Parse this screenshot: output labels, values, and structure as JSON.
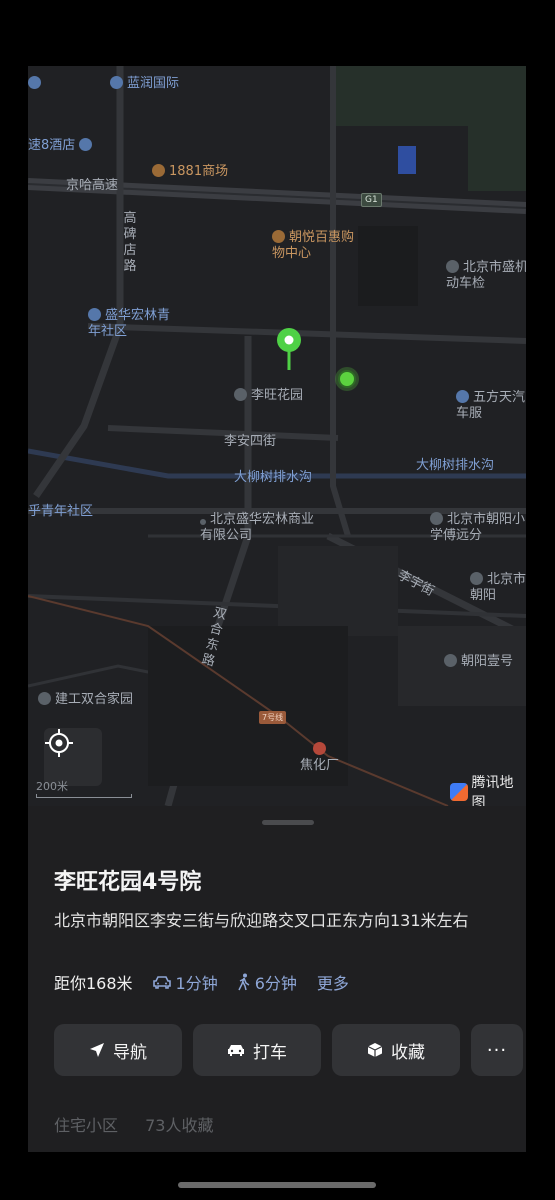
{
  "map": {
    "labels": {
      "lanrun": "蓝润国际",
      "hotel8": "速8酒店",
      "mall1881": "1881商场",
      "jingha": "京哈高速",
      "g1": "G1",
      "gaobeidian": "高碑店路",
      "chaoyue": "朝悦百惠购物中心",
      "beijing_shengjidong": "北京市盛机动车检",
      "shenghua": "盛华宏林青年社区",
      "liwang": "李旺花园",
      "wufang": "五方天汽车服",
      "lian4": "李安四街",
      "dalius_a": "大柳树排水沟",
      "dalius_b": "大柳树排水沟",
      "qingnian": "乎青年社区",
      "shenghua_co": "北京盛华宏林商业有限公司",
      "chaoyang_school": "北京市朝阳小学傅远分",
      "liyuejie": "李宇街",
      "beijing_chaoyang": "北京市朝阳",
      "shuanghe": "双合东路",
      "chaoyang_ya": "朝阳壹号",
      "jiangong": "建工双合家园",
      "line7": "7号线",
      "jiaohua": "焦化厂"
    },
    "scale_label": "200米",
    "logo_text": "腾讯地图",
    "colors": {
      "background": "#202124",
      "road": "#34363a",
      "water": "#2e3a52",
      "pin": "#4fd146"
    }
  },
  "place": {
    "title": "李旺花园4号院",
    "address": "北京市朝阳区李安三街与欣迎路交叉口正东方向131米左右",
    "distance": "距你168米",
    "drive_time": "1分钟",
    "walk_time": "6分钟",
    "more": "更多"
  },
  "actions": {
    "navigate": "导航",
    "taxi": "打车",
    "favorite": "收藏",
    "more": "···"
  },
  "sub": {
    "category": "住宅小区",
    "favorites_count": "73人收藏"
  }
}
